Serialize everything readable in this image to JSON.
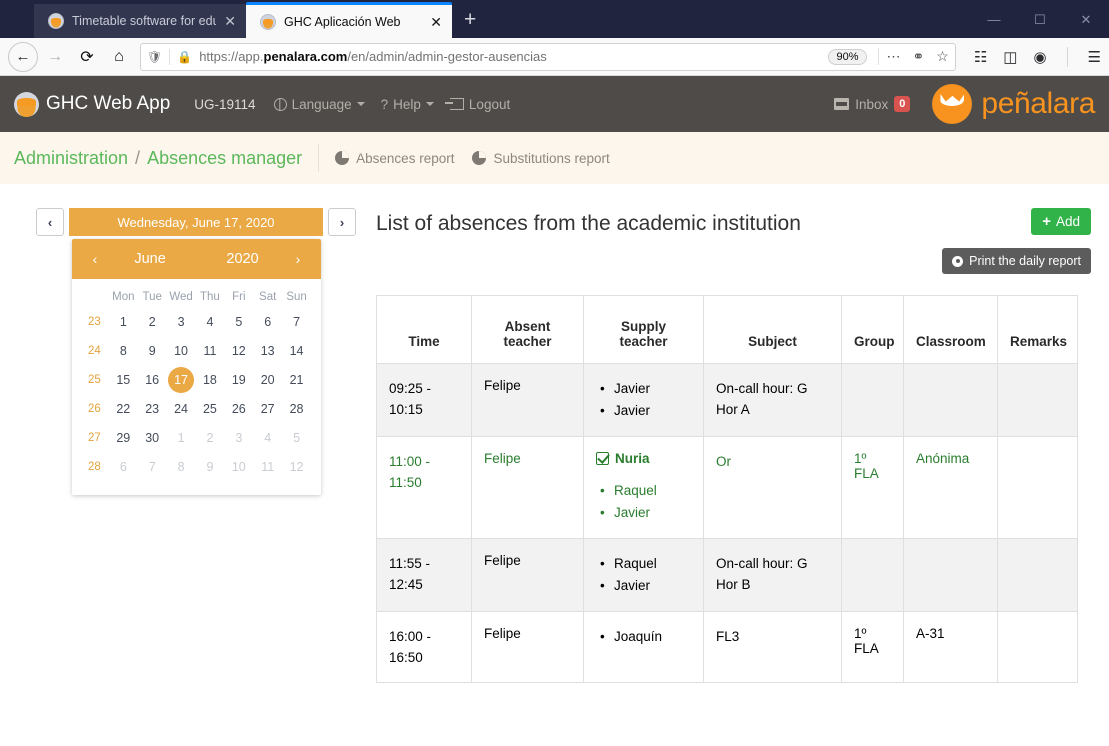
{
  "browser": {
    "tabs": [
      {
        "title": "Timetable software for educatio",
        "favicon": "penalara-favicon",
        "active": false
      },
      {
        "title": "GHC Aplicación Web",
        "favicon": "penalara-favicon",
        "active": true
      }
    ],
    "newtab_label": "+",
    "window_controls": {
      "minimize": "—",
      "maximize": "☐",
      "close": "✕"
    },
    "nav": {
      "back": "←",
      "forward": "→",
      "reload": "⟳",
      "home": "⌂"
    },
    "url": {
      "scheme_path_pre": "https://app.",
      "domain": "penalara.com",
      "path": "/en/admin/admin-gestor-ausencias",
      "shield_icon": "shield-icon",
      "lock_icon": "lock-icon",
      "zoom_level": "90%",
      "menu_icon": "⋯",
      "pocket_icon": "pocket-icon",
      "star_icon": "☆"
    },
    "toolbar_icons": {
      "library": "library-icon",
      "sidebar": "sidebar-icon",
      "account": "account-icon",
      "menu": "☰"
    }
  },
  "app_header": {
    "brand": "GHC Web App",
    "user_code": "UG-19114",
    "language_label": "Language",
    "help_label": "Help",
    "logout_label": "Logout",
    "inbox_label": "Inbox",
    "inbox_count": "0",
    "company": "peñalara"
  },
  "breadcrumb": {
    "root": "Administration",
    "separator": "/",
    "current": "Absences manager",
    "links": [
      {
        "label": "Absences report"
      },
      {
        "label": "Substitutions report"
      }
    ]
  },
  "datepicker": {
    "prev_label": "‹",
    "next_label": "›",
    "selected_date_text": "Wednesday, June 17, 2020",
    "cal_prev": "‹",
    "cal_next": "›",
    "month": "June",
    "year": "2020",
    "weekday_headers": [
      "",
      "Mon",
      "Tue",
      "Wed",
      "Thu",
      "Fri",
      "Sat",
      "Sun"
    ],
    "weeks": [
      {
        "week": "23",
        "days": [
          {
            "d": "1",
            "out": false
          },
          {
            "d": "2",
            "out": false
          },
          {
            "d": "3",
            "out": false
          },
          {
            "d": "4",
            "out": false
          },
          {
            "d": "5",
            "out": false
          },
          {
            "d": "6",
            "out": false
          },
          {
            "d": "7",
            "out": false
          }
        ]
      },
      {
        "week": "24",
        "days": [
          {
            "d": "8",
            "out": false
          },
          {
            "d": "9",
            "out": false
          },
          {
            "d": "10",
            "out": false
          },
          {
            "d": "11",
            "out": false
          },
          {
            "d": "12",
            "out": false
          },
          {
            "d": "13",
            "out": false
          },
          {
            "d": "14",
            "out": false
          }
        ]
      },
      {
        "week": "25",
        "days": [
          {
            "d": "15",
            "out": false
          },
          {
            "d": "16",
            "out": false
          },
          {
            "d": "17",
            "out": false,
            "selected": true
          },
          {
            "d": "18",
            "out": false
          },
          {
            "d": "19",
            "out": false
          },
          {
            "d": "20",
            "out": false
          },
          {
            "d": "21",
            "out": false
          }
        ]
      },
      {
        "week": "26",
        "days": [
          {
            "d": "22",
            "out": false
          },
          {
            "d": "23",
            "out": false
          },
          {
            "d": "24",
            "out": false
          },
          {
            "d": "25",
            "out": false
          },
          {
            "d": "26",
            "out": false
          },
          {
            "d": "27",
            "out": false
          },
          {
            "d": "28",
            "out": false
          }
        ]
      },
      {
        "week": "27",
        "days": [
          {
            "d": "29",
            "out": false
          },
          {
            "d": "30",
            "out": false
          },
          {
            "d": "1",
            "out": true
          },
          {
            "d": "2",
            "out": true
          },
          {
            "d": "3",
            "out": true
          },
          {
            "d": "4",
            "out": true
          },
          {
            "d": "5",
            "out": true
          }
        ]
      },
      {
        "week": "28",
        "days": [
          {
            "d": "6",
            "out": true
          },
          {
            "d": "7",
            "out": true
          },
          {
            "d": "8",
            "out": true
          },
          {
            "d": "9",
            "out": true
          },
          {
            "d": "10",
            "out": true
          },
          {
            "d": "11",
            "out": true
          },
          {
            "d": "12",
            "out": true
          }
        ]
      }
    ]
  },
  "main": {
    "title": "List of absences from the academic institution",
    "add_label": "Add",
    "print_label": "Print the daily report",
    "columns": [
      "Time",
      "Absent teacher",
      "Supply teacher",
      "Subject",
      "Group",
      "Classroom",
      "Remarks"
    ],
    "rows": [
      {
        "time": [
          "09:25 -",
          "10:15"
        ],
        "absent": "Felipe",
        "supply_lead": "",
        "supply_list": [
          "Javier",
          "Javier"
        ],
        "subject": [
          "On-call hour: G",
          "Hor A"
        ],
        "group": "",
        "classroom": "",
        "remarks": "",
        "green": false
      },
      {
        "time": [
          "11:00 -",
          "11:50"
        ],
        "absent": "Felipe",
        "supply_lead": "Nuria",
        "supply_list": [
          "Raquel",
          "Javier"
        ],
        "subject": [
          "Or"
        ],
        "group": "1º FLA",
        "classroom": "Anónima",
        "remarks": "",
        "green": true
      },
      {
        "time": [
          "11:55 -",
          "12:45"
        ],
        "absent": "Felipe",
        "supply_lead": "",
        "supply_list": [
          "Raquel",
          "Javier"
        ],
        "subject": [
          "On-call hour: G",
          "Hor B"
        ],
        "group": "",
        "classroom": "",
        "remarks": "",
        "green": false
      },
      {
        "time": [
          "16:00 -",
          "16:50"
        ],
        "absent": "Felipe",
        "supply_lead": "",
        "supply_list": [
          "Joaquín"
        ],
        "subject": [
          "FL3"
        ],
        "group": "1º FLA",
        "classroom": "A-31",
        "remarks": "",
        "green": false
      }
    ]
  },
  "colors": {
    "accent_orange": "#eaa944",
    "brand_orange": "#f7931e",
    "green": "#5cb85c",
    "row_green_text": "#2a7d2e",
    "add_green": "#31b34a",
    "header_dark": "#4e4b48",
    "breadcrumb_bg": "#fdf6ec",
    "titlebar": "#20243f"
  }
}
